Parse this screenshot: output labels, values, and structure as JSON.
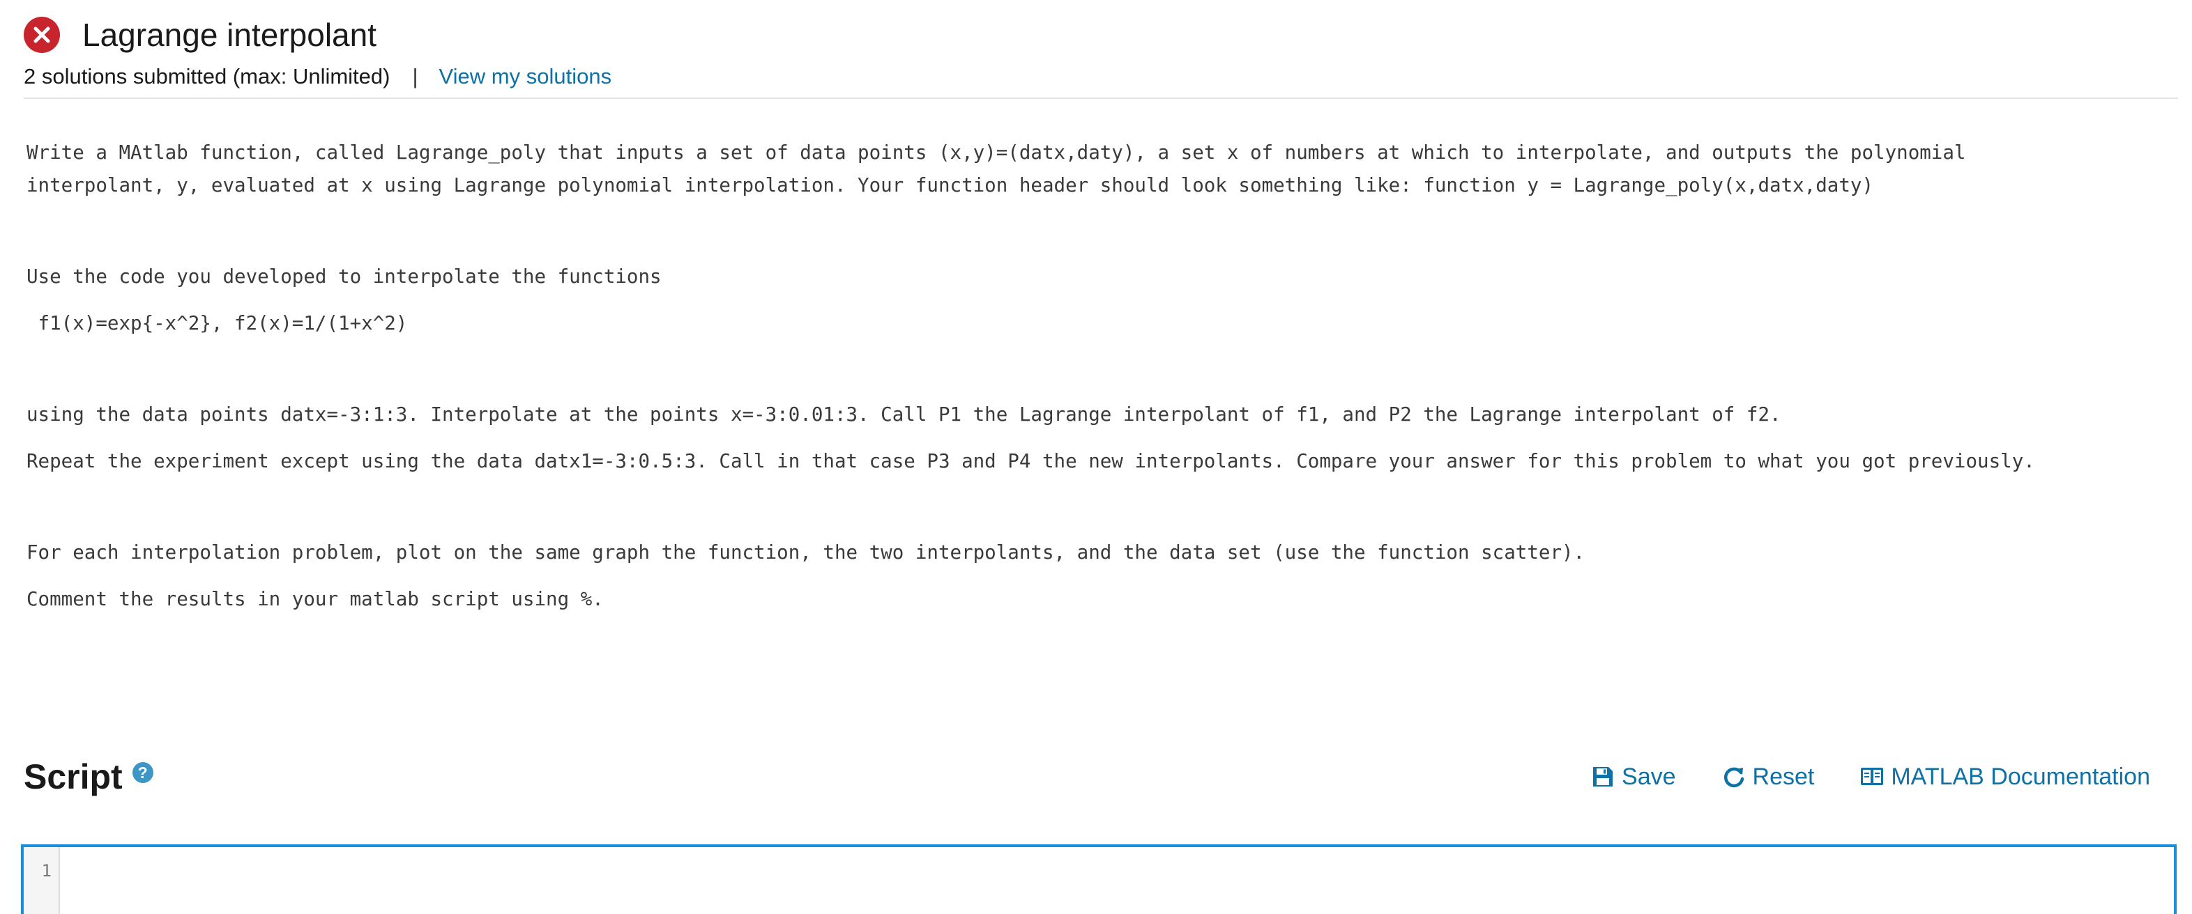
{
  "problem": {
    "title": "Lagrange interpolant",
    "status": "incorrect",
    "submission_info": "2 solutions submitted (max: Unlimited)",
    "separator": "|",
    "view_solutions_label": "View my solutions"
  },
  "description": {
    "p1": "Write a MAtlab function, called Lagrange_poly that inputs a set of data points (x,y)=(datx,daty), a set x of numbers at which to interpolate, and outputs the polynomial\ninterpolant, y, evaluated at x using Lagrange polynomial interpolation. Your function header should look something like: function y = Lagrange_poly(x,datx,daty)",
    "p2": "Use the code you developed to interpolate the functions",
    "p3": " f1(x)=exp{-x^2}, f2(x)=1/(1+x^2)",
    "p4": "using the data points datx=-3:1:3. Interpolate at the points x=-3:0.01:3. Call P1 the Lagrange interpolant of f1, and P2 the Lagrange interpolant of f2.",
    "p5": "Repeat the experiment except using the data datx1=-3:0.5:3. Call in that case P3 and P4 the new interpolants. Compare your answer for this problem to what you got previously.",
    "p6": "For each interpolation problem, plot on the same graph the function, the two interpolants, and the data set (use the function scatter).",
    "p7": "Comment the results in your matlab script using %."
  },
  "script": {
    "title": "Script",
    "help_icon": "question-circle-icon",
    "toolbar": {
      "save_label": "Save",
      "reset_label": "Reset",
      "docs_label": "MATLAB Documentation"
    },
    "editor": {
      "line_numbers": [
        "1"
      ]
    }
  },
  "colors": {
    "link": "#0e71a6",
    "error": "#c8242d",
    "editor_focus": "#1b8fdc",
    "help_icon": "#3c97c7"
  }
}
